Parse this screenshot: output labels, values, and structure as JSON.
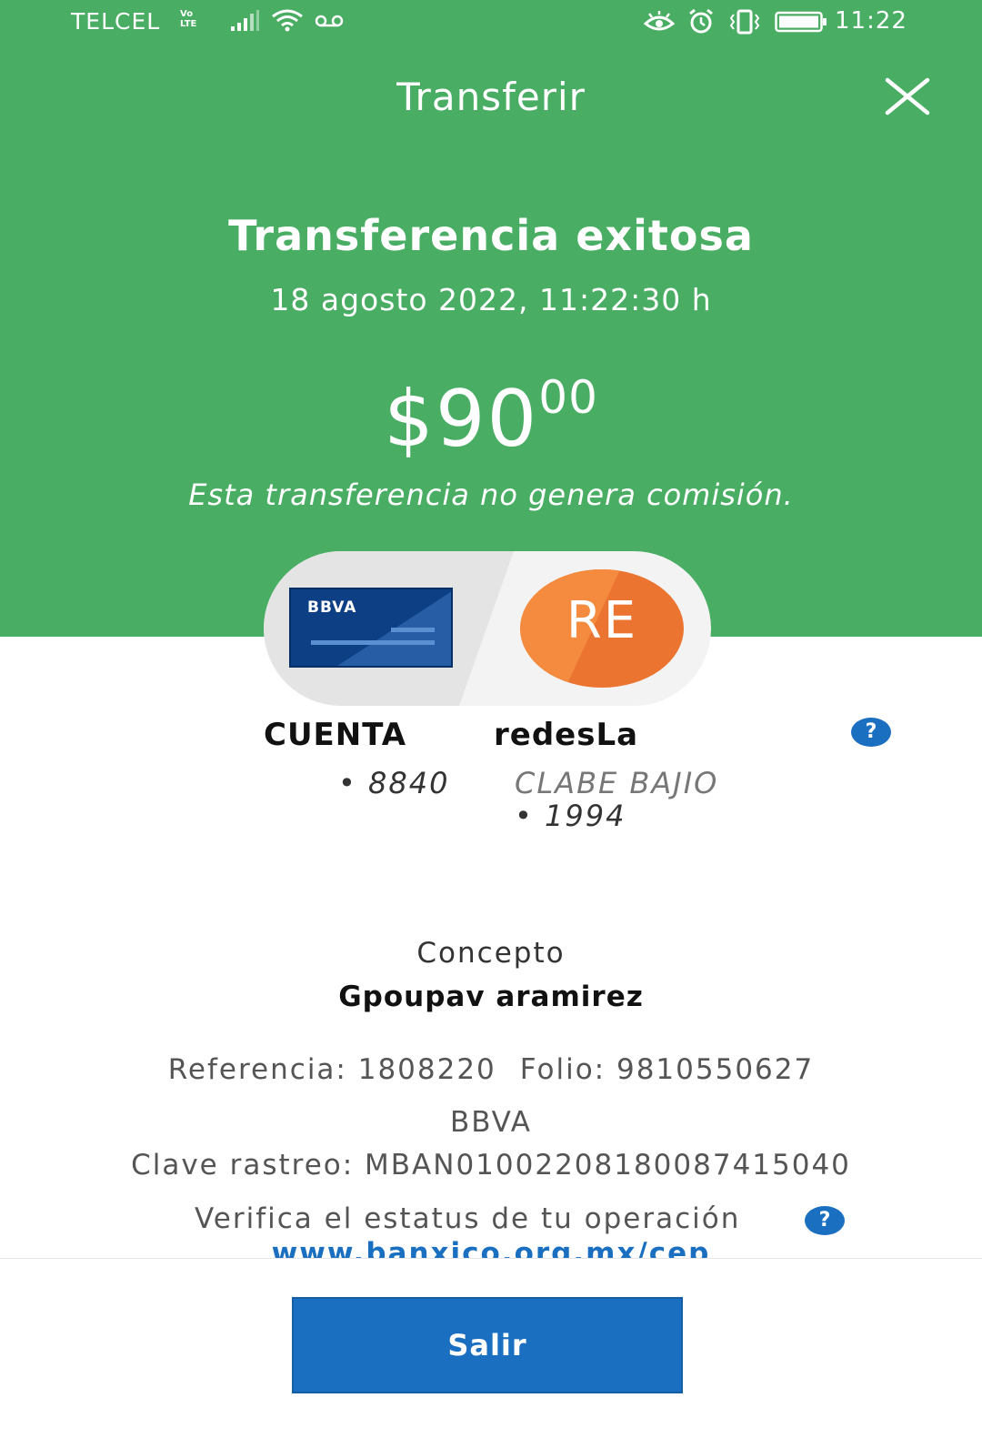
{
  "status_bar": {
    "carrier": "TELCEL",
    "volte_top": "Vo",
    "volte_bottom": "LTE",
    "time": "11:22"
  },
  "header": {
    "title": "Transferir"
  },
  "result": {
    "title": "Transferencia exitosa",
    "datetime": "18 agosto 2022, 11:22:30 h",
    "amount_main": "$90",
    "amount_cents": "00",
    "fee_note": "Esta transferencia no genera comisión."
  },
  "from_account": {
    "card_brand": "BBVA",
    "name": "CUENTA",
    "number": "• 8840"
  },
  "to_account": {
    "initials": "RE",
    "name": "redesLa",
    "bank": "CLABE BAJIO",
    "number": "• 1994"
  },
  "details": {
    "concept_label": "Concepto",
    "concept_value": "Gpoupav aramirez",
    "reference": "Referencia: 1808220",
    "folio": "Folio: 9810550627",
    "bank": "BBVA",
    "tracking": "Clave rastreo: MBAN01002208180087415040",
    "verify_text": "Verifica el estatus de tu operación",
    "verify_link": "www.banxico.org.mx/cep"
  },
  "help_icon_text": "?",
  "footer": {
    "exit_label": "Salir"
  },
  "colors": {
    "header_green": "#49ad63",
    "primary_blue": "#1a6fc0",
    "avatar_orange": "#ec7431",
    "card_navy": "#0c3f84"
  }
}
